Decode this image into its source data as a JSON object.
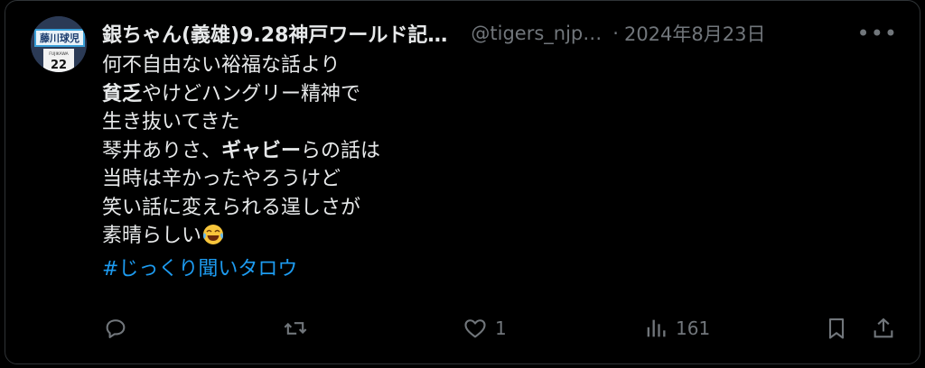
{
  "post": {
    "display_name": "銀ちゃん(義雄)9.28神戸ワールド記…",
    "handle": "@tigers_njp…",
    "separator": "·",
    "date": "2024年8月23日",
    "more": "•••",
    "avatar": {
      "banner_text": "藤川球児",
      "jersey_name": "FUJIKAWA",
      "jersey_number": "22"
    },
    "lines": [
      [
        "何不自由ない裕福な話より"
      ],
      [
        "貧乏",
        "やけどハングリー精神で"
      ],
      [
        "生き抜いてきた"
      ],
      [
        "琴井ありさ、",
        "ギャビー",
        "らの話は"
      ],
      [
        "当時は辛かったやろうけど"
      ],
      [
        "笑い話に変えられる逞しさが"
      ],
      [
        "素晴らしい"
      ]
    ],
    "hashtag": "#じっくり聞いタロウ",
    "emoji": "face-with-tears-of-joy"
  },
  "actions": {
    "reply_count": "",
    "repost_count": "",
    "like_count": "1",
    "views_count": "161"
  },
  "colors": {
    "background": "#000000",
    "text": "#e7e9ea",
    "muted": "#71767b",
    "link": "#1d9bf0",
    "border": "#2f3336"
  }
}
